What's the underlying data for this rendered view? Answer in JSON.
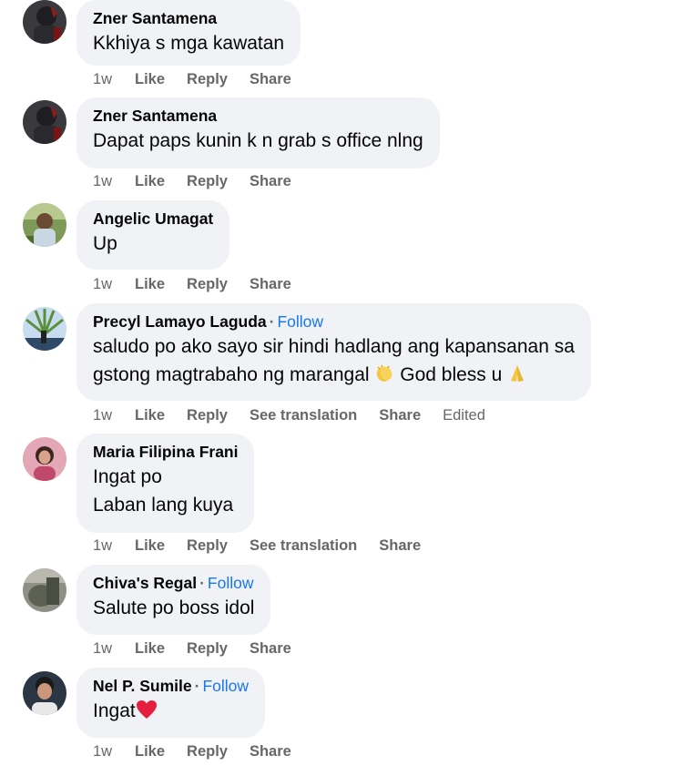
{
  "action_labels": {
    "time": "1w",
    "like": "Like",
    "reply": "Reply",
    "share": "Share",
    "see_translation": "See translation",
    "edited": "Edited"
  },
  "comments": [
    {
      "author": "Zner Santamena",
      "follow": "",
      "lines": [
        "Kkhiya s mga kawatan"
      ],
      "avatar_icon": "person-dark-avatar",
      "translation": false,
      "edited": false
    },
    {
      "author": "Zner Santamena",
      "follow": "",
      "lines": [
        "Dapat paps kunin k n grab s office nlng"
      ],
      "avatar_icon": "person-dark-avatar",
      "translation": false,
      "edited": false
    },
    {
      "author": "Angelic Umagat",
      "follow": "",
      "lines": [
        "Up"
      ],
      "avatar_icon": "outdoor-green-avatar",
      "translation": false,
      "edited": false
    },
    {
      "author": "Precyl Lamayo Laguda",
      "follow": "Follow",
      "lines": [
        "saludo po ako sayo sir hindi hadlang ang kapansanan sa",
        "gstong magtrabaho ng marangal",
        "God bless u"
      ],
      "avatar_icon": "sky-avatar",
      "translation": true,
      "edited": true
    },
    {
      "author": "Maria Filipina Frani",
      "follow": "",
      "lines": [
        "Ingat po",
        "Laban lang kuya"
      ],
      "avatar_icon": "portrait-pink-avatar",
      "translation": true,
      "edited": false
    },
    {
      "author": "Chiva's Regal",
      "follow": "Follow",
      "lines": [
        "Salute po boss idol"
      ],
      "avatar_icon": "landscape-grey-avatar",
      "translation": false,
      "edited": false
    },
    {
      "author": "Nel P. Sumile",
      "follow": "Follow",
      "lines": [
        "Ingat"
      ],
      "avatar_icon": "portrait-man-avatar",
      "translation": false,
      "edited": false
    }
  ],
  "colors": {
    "bubble": "#f0f2f5",
    "meta": "#65676b",
    "follow": "#1877f2",
    "heart": "#e41e3f"
  }
}
